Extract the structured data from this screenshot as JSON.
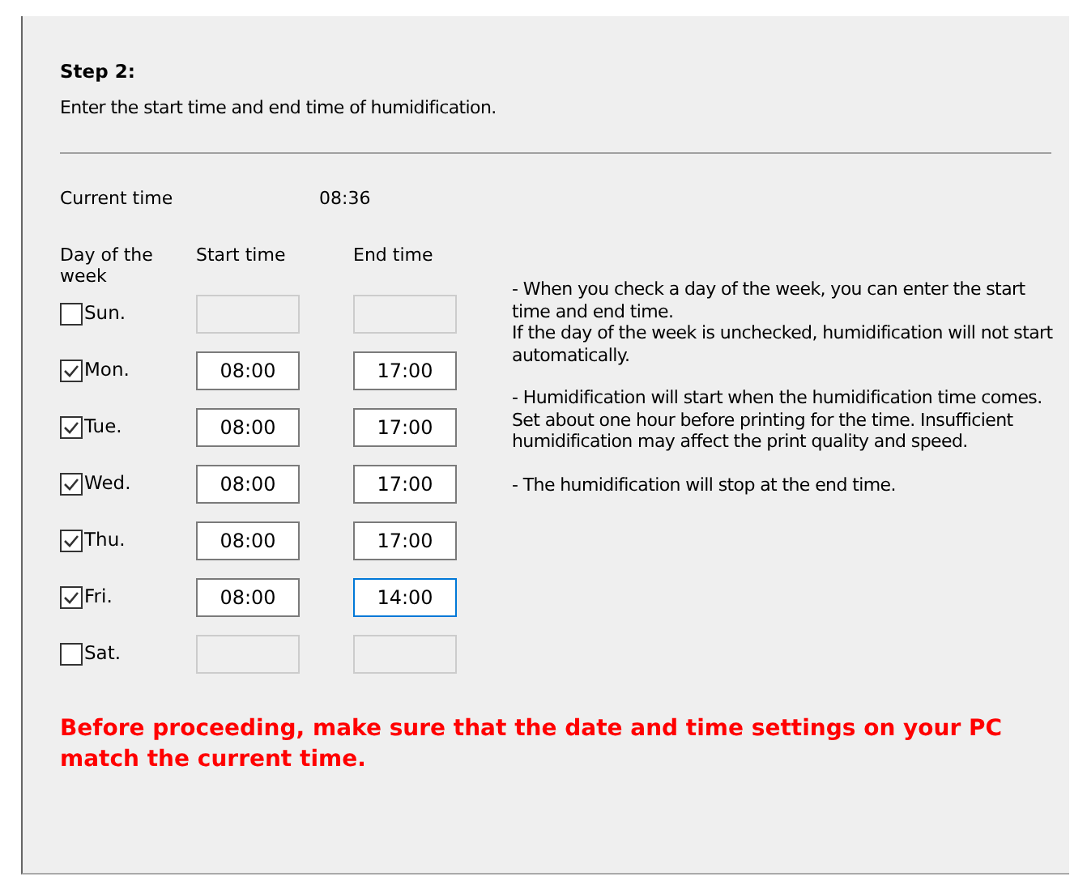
{
  "step": {
    "title": "Step 2:",
    "instruction": "Enter the start time and end time of humidification."
  },
  "current_time": {
    "label": "Current time",
    "value": "08:36"
  },
  "columns": [
    "Day of the week",
    "Start time",
    "End time"
  ],
  "days": [
    {
      "label": "Sun.",
      "checked": false
    },
    {
      "label": "Mon.",
      "checked": true,
      "start": "08:00",
      "end": "17:00",
      "focused": false
    },
    {
      "label": "Tue.",
      "checked": true,
      "start": "08:00",
      "end": "17:00",
      "focused": false
    },
    {
      "label": "Wed.",
      "checked": true,
      "start": "08:00",
      "end": "17:00",
      "focused": false
    },
    {
      "label": "Thu.",
      "checked": true,
      "start": "08:00",
      "end": "17:00",
      "focused": false
    },
    {
      "label": "Fri.",
      "checked": true,
      "start": "08:00",
      "end": "14:00",
      "focused": true
    },
    {
      "label": "Sat.",
      "checked": false
    }
  ],
  "notes": [
    "- When you check a day of the week, you can enter the start time and end time.\nIf the day of the week is unchecked, humidification will not start automatically.",
    "- Humidification will start when the humidification time comes. Set about one hour before printing for the time. Insufficient humidification may affect the print quality and speed.",
    "- The humidification will stop at the end time."
  ],
  "warning": "Before proceeding, make sure that the date and time settings on your PC match the current time."
}
